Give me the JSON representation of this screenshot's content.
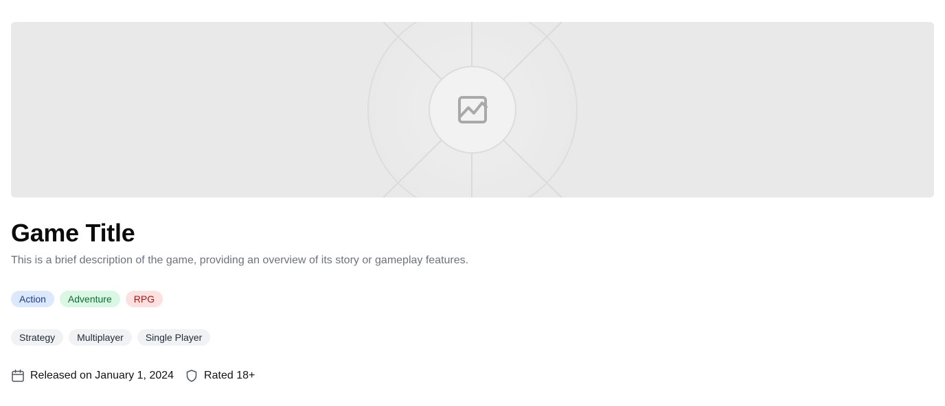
{
  "hero": {
    "background": "#e9e9e9",
    "icon": "image-placeholder-icon"
  },
  "game": {
    "title": "Game Title",
    "description": "This is a brief description of the game, providing an overview of its story or gameplay features."
  },
  "genres": [
    {
      "label": "Action",
      "bg": "#dbe8fd",
      "fg": "#1e3a8a"
    },
    {
      "label": "Adventure",
      "bg": "#d9f8e3",
      "fg": "#166534"
    },
    {
      "label": "RPG",
      "bg": "#fde0e0",
      "fg": "#991b1b"
    }
  ],
  "modes": [
    {
      "label": "Strategy",
      "bg": "#f1f2f4",
      "fg": "#1f2937"
    },
    {
      "label": "Multiplayer",
      "bg": "#f1f2f4",
      "fg": "#1f2937"
    },
    {
      "label": "Single Player",
      "bg": "#f1f2f4",
      "fg": "#1f2937"
    }
  ],
  "meta": {
    "release_icon": "calendar-icon",
    "release": "Released on January 1, 2024",
    "rating_icon": "shield-icon",
    "rating": "Rated 18+"
  }
}
